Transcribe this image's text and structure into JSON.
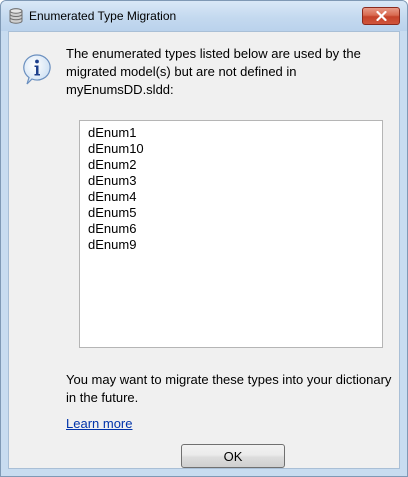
{
  "window": {
    "title": "Enumerated Type Migration",
    "title_icon": "database-icon",
    "close_icon": "close-icon"
  },
  "dialog": {
    "icon": "info-icon",
    "message": "The enumerated types listed below are used by the migrated model(s) but are not defined in myEnumsDD.sldd:",
    "types": [
      "dEnum1",
      "dEnum10",
      "dEnum2",
      "dEnum3",
      "dEnum4",
      "dEnum5",
      "dEnum6",
      "dEnum9"
    ],
    "note": "You may want to migrate these types into your dictionary in the future.",
    "learn_more": "Learn more",
    "ok_label": "OK"
  },
  "colors": {
    "link": "#0033aa",
    "close_button": "#c5432a",
    "titlebar": "#c4d9ef"
  }
}
